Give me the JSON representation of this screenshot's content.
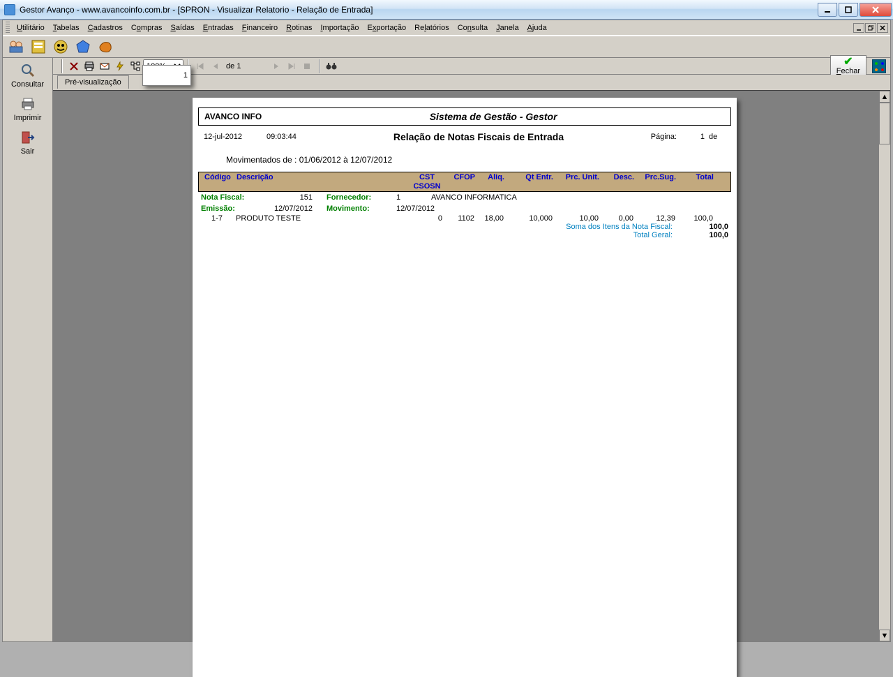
{
  "window": {
    "title": "Gestor Avanço - www.avancoinfo.com.br - [SPRON - Visualizar Relatorio - Relação de Entrada]"
  },
  "menu": {
    "items": [
      "Utilitário",
      "Tabelas",
      "Cadastros",
      "Compras",
      "Saídas",
      "Entradas",
      "Financeiro",
      "Rotinas",
      "Importação",
      "Exportação",
      "Relatórios",
      "Consulta",
      "Janela",
      "Ajuda"
    ]
  },
  "sidebar": {
    "consultar": "Consultar",
    "imprimir": "Imprimir",
    "sair": "Sair"
  },
  "rtoolbar": {
    "zoom": "100%",
    "page_current": "1",
    "page_of_prefix": "de",
    "page_total": "1",
    "fechar": "Fechar"
  },
  "tab": {
    "preview": "Pré-visualização"
  },
  "report": {
    "company": "AVANCO INFO",
    "system_title": "Sistema de Gestão - Gestor",
    "date": "12-jul-2012",
    "time": "09:03:44",
    "title": "Relação de Notas Fiscais de Entrada",
    "pagina_label": "Página:",
    "pagina_num": "1",
    "pagina_de": "de",
    "movimentados": "Movimentados de : 01/06/2012 à 12/07/2012",
    "col": {
      "codigo": "Código",
      "descricao": "Descrição",
      "cst": "CST",
      "csosn": "CSOSN",
      "cfop": "CFOP",
      "aliq": "Aliq.",
      "qt": "Qt Entr.",
      "pu": "Prc. Unit.",
      "desc": "Desc.",
      "ps": "Prc.Sug.",
      "tot": "Total"
    },
    "nf": {
      "nf_label": "Nota Fiscal:",
      "nf_num": "151",
      "forn_label": "Fornecedor:",
      "forn_cod": "1",
      "forn_nome": "AVANCO INFORMATICA",
      "emissao_label": "Emissão:",
      "emissao_val": "12/07/2012",
      "mov_label": "Movimento:",
      "mov_val": "12/07/2012"
    },
    "item": {
      "codigo": "1-7",
      "descricao": "PRODUTO TESTE",
      "cst": "0",
      "cfop": "1102",
      "aliq": "18,00",
      "qt": "10,000",
      "pu": "10,00",
      "desc": "0,00",
      "ps": "12,39",
      "tot": "100,0"
    },
    "soma_label": "Soma dos Itens da Nota Fiscal:",
    "soma_val": "100,0",
    "total_label": "Total Geral:",
    "total_val": "100,0"
  }
}
